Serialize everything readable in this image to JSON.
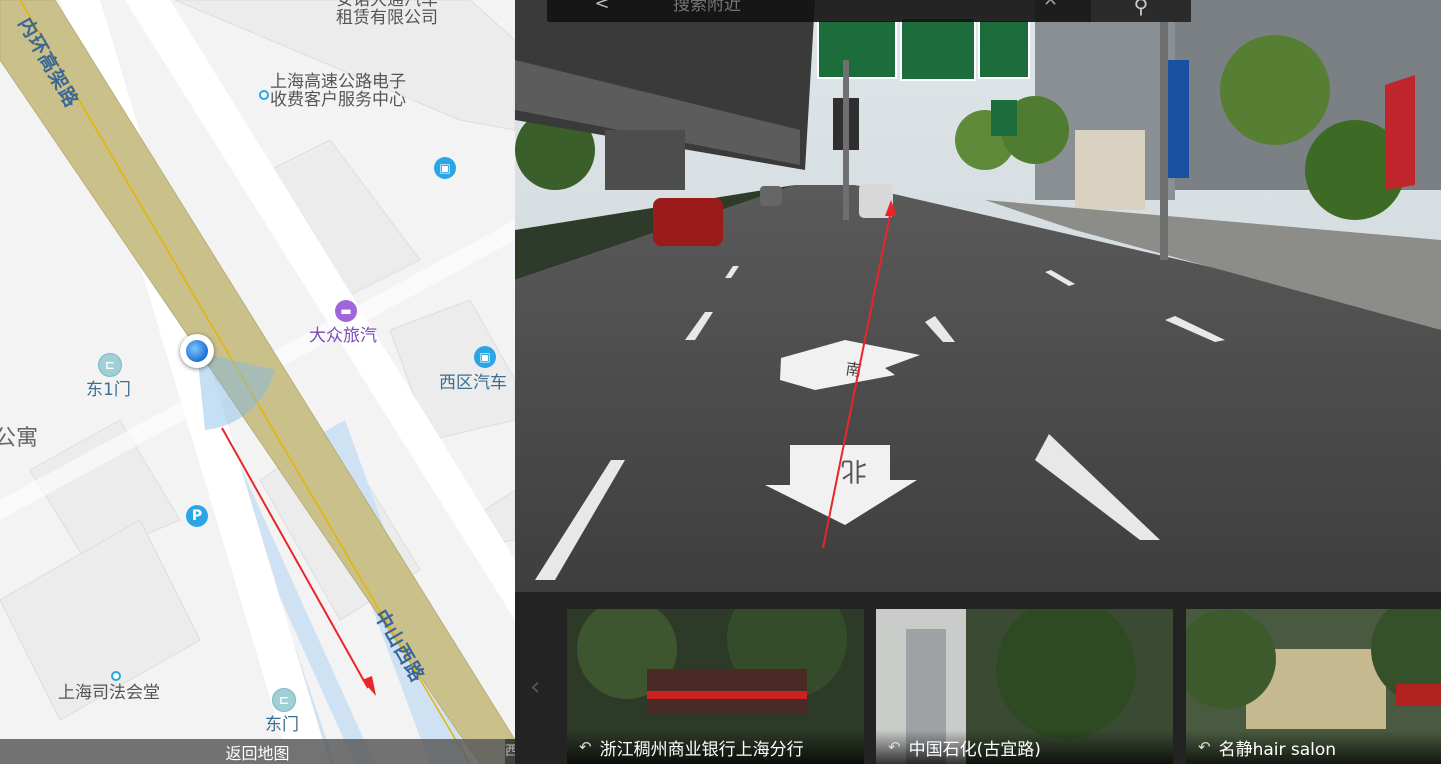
{
  "map": {
    "labels": {
      "rental_company": "安诺大通汽车\n租赁有限公司",
      "highway_center": "上海高速公路电子\n收费客户服务中心",
      "hotel": "大众旅汽",
      "east_gate_1": "东1门",
      "west_auto": "西区汽车",
      "apartment": "公寓",
      "judicial_hall": "上海司法会堂",
      "east_gate": "东门",
      "inner_ring": "内环高架路",
      "zhongshan_west": "中山西路"
    },
    "icons": {
      "bus": "bus-icon",
      "gate": "gate-icon",
      "hotel": "hotel-icon",
      "parking": "P"
    },
    "back_label": "返回地图",
    "edge_label": "西"
  },
  "search": {
    "placeholder": "搜索附近",
    "back_glyph": "<",
    "clear_glyph": "✕",
    "search_icon": "⚲"
  },
  "street": {
    "arrow_fwd_label": "南",
    "arrow_back_label": "北"
  },
  "thumbs": [
    {
      "caption": "浙江稠州商业银行上海分行"
    },
    {
      "caption": "中国石化(古宜路)"
    },
    {
      "caption": "名静hair salon"
    }
  ],
  "colors": {
    "expressway": "#c9c08a",
    "minor_road": "#cfe2f3",
    "arrow": "#e8262a"
  }
}
